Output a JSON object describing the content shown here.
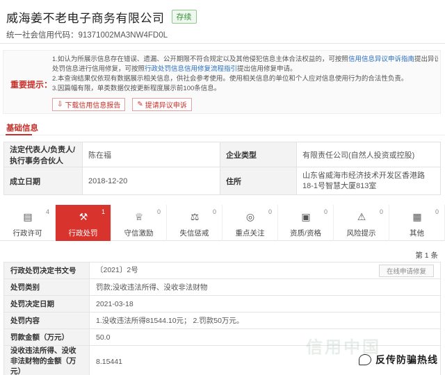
{
  "header": {
    "company_name": "威海姜不老电子商务有限公司",
    "status": "存续",
    "credit_code": "统一社会信用代码：91371002MA3NW4FD0L"
  },
  "notice": {
    "label": "重要提示：",
    "line1_a": "1.如认为所展示信息存在错误、遗漏、公开期限不符合规定以及其他侵犯信息主体合法权益的，可按照",
    "line1_link": "信用信息异议申诉指南",
    "line1_b": "提出异议申诉；如需对相关行政",
    "line1c_a": "处罚信息进行信用修复，可按照",
    "line1c_link": "行政处罚信息信用修复流程指引",
    "line1c_b": "提出信用修复申请。",
    "line2": "2.本查询结果仅依现有数据展示相关信息，供社会参考使用。使用相关信息的单位和个人应对信息使用行为的合法性负责。",
    "line3": "3.因篇幅有限，单类数据仅按更新程度展示前100条信息。",
    "btn_download": "下载信用信息报告",
    "btn_appeal": "提请异议申诉"
  },
  "basic_info": {
    "title": "基础信息",
    "legal_rep_label": "法定代表人/负责人/执行事务合伙人",
    "legal_rep_value": "陈在福",
    "type_label": "企业类型",
    "type_value": "有限责任公司(自然人投资或控股)",
    "date_label": "成立日期",
    "date_value": "2018-12-20",
    "address_label": "住所",
    "address_value": "山东省威海市经济技术开发区香港路18-1号智慧大厦813室"
  },
  "tabs": [
    {
      "label": "行政许可",
      "count": "4",
      "icon": "license-icon"
    },
    {
      "label": "行政处罚",
      "count": "1",
      "icon": "gavel-icon"
    },
    {
      "label": "守信激励",
      "count": "0",
      "icon": "reward-icon"
    },
    {
      "label": "失信惩戒",
      "count": "0",
      "icon": "scale-icon"
    },
    {
      "label": "重点关注",
      "count": "0",
      "icon": "target-icon"
    },
    {
      "label": "资质/资格",
      "count": "0",
      "icon": "qualification-icon"
    },
    {
      "label": "风险提示",
      "count": "0",
      "icon": "alarm-icon"
    },
    {
      "label": "其他",
      "count": "0",
      "icon": "other-icon"
    }
  ],
  "page_count": "第 1 条",
  "penalty": {
    "doc_label": "行政处罚决定书文号",
    "doc_value": "〔2021〕2号",
    "apply_btn": "在线申请修复",
    "category_label": "处罚类别",
    "category_value": "罚款;没收违法所得、没收非法财物",
    "date_label": "处罚决定日期",
    "date_value": "2021-03-18",
    "content_label": "处罚内容",
    "content_value": "1.没收违法所得81544.10元； 2.罚款50万元。",
    "amount_label": "罚款金额（万元）",
    "amount_value": "50.0",
    "confiscate_label": "没收违法所得、没收非法财物的金额（万元）",
    "confiscate_value": "8.15441"
  },
  "watermark": "信用中国",
  "footer": "反传防骗热线"
}
